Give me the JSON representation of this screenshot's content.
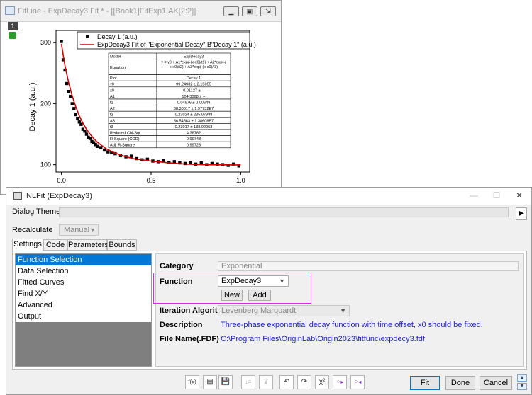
{
  "graph_window": {
    "title": "FitLine - ExpDecay3 Fit * - [[Book1]FitExp1!AK[2:2]]",
    "layer_number": "1",
    "legend": {
      "scatter_label": "Decay 1 (a.u.)",
      "fit_label": "ExpDecay3 Fit of \"Exponential Decay\" B\"Decay 1\" (a.u.)"
    },
    "y_axis_label": "Decay 1 (a.u.)",
    "x_ticks": [
      "0.0",
      "0.5",
      "1.0"
    ],
    "y_ticks": [
      "100",
      "200",
      "300"
    ],
    "results_table": {
      "header": [
        "Model",
        "ExpDecay3"
      ],
      "equation_label": "Equation",
      "equation_lines": [
        "y = y0 + A1*exp(-(x-x0)/t1) + A2*exp(-(",
        "x-x0)/t2) + A3*exp(-(x-x0)/t3)"
      ],
      "plot_row": [
        "Plot",
        "Decay 1"
      ],
      "rows": [
        [
          "y0",
          "99.24932 ± 2.15055"
        ],
        [
          "x0",
          "0.01127 ± --"
        ],
        [
          "A1",
          "104.3068 ± --"
        ],
        [
          "t1",
          "0.04976 ± 0.00649"
        ],
        [
          "A2",
          "38.30017 ± 1.97732E7"
        ],
        [
          "t2",
          "0.23024 ± 235.07988"
        ],
        [
          "A3",
          "56.54583 ± 1.38608E7"
        ],
        [
          "t3",
          "0.23017 ± 138.92953"
        ],
        [
          "Reduced Chi-Sqr",
          "4.38782"
        ],
        [
          "R-Square (COD)",
          "0.99748"
        ],
        [
          "Adj. R-Square",
          "0.99728"
        ]
      ]
    },
    "colors": {
      "fit_line": "#d40000",
      "scatter": "#000000"
    }
  },
  "chart_data": {
    "type": "scatter",
    "xlim": [
      -0.03,
      1.05
    ],
    "ylim": [
      88,
      320
    ],
    "series": [
      {
        "name": "Decay 1 (a.u.)",
        "x": [
          0.0,
          0.01,
          0.02,
          0.03,
          0.04,
          0.05,
          0.06,
          0.07,
          0.08,
          0.09,
          0.1,
          0.11,
          0.12,
          0.13,
          0.14,
          0.15,
          0.16,
          0.17,
          0.18,
          0.19,
          0.2,
          0.22,
          0.24,
          0.26,
          0.28,
          0.3,
          0.33,
          0.36,
          0.39,
          0.42,
          0.45,
          0.48,
          0.51,
          0.54,
          0.57,
          0.6,
          0.63,
          0.66,
          0.69,
          0.72,
          0.75,
          0.78,
          0.81,
          0.84,
          0.87,
          0.9,
          0.93,
          0.96,
          0.99
        ],
        "y": [
          302,
          272,
          255,
          233,
          220,
          212,
          200,
          192,
          182,
          176,
          170,
          166,
          158,
          155,
          150,
          145,
          143,
          138,
          136,
          133,
          130,
          128,
          124,
          121,
          120,
          118,
          115,
          113,
          114,
          110,
          108,
          109,
          106,
          105,
          107,
          104,
          105,
          103,
          102,
          104,
          101,
          103,
          100,
          102,
          101,
          100,
          99,
          101,
          98
        ]
      },
      {
        "name": "ExpDecay3 Fit of \"Exponential Decay\" B\"Decay 1\" (a.u.)",
        "x": [
          0.0,
          0.02,
          0.04,
          0.06,
          0.08,
          0.1,
          0.12,
          0.14,
          0.16,
          0.18,
          0.2,
          0.25,
          0.3,
          0.35,
          0.4,
          0.5,
          0.6,
          0.7,
          0.8,
          0.9,
          1.0
        ],
        "y": [
          298,
          262,
          235,
          213,
          195,
          180,
          168,
          158,
          150,
          143,
          137,
          126,
          119,
          114,
          110,
          106,
          103,
          101,
          100,
          99.8,
          99.5
        ]
      }
    ]
  },
  "dialog": {
    "title": "NLFit (ExpDecay3)",
    "window_buttons": [
      "—",
      "☐",
      "✕"
    ],
    "theme_label": "Dialog Theme",
    "theme_arrow": "▶",
    "recalc_label": "Recalculate",
    "recalc_value": "Manual",
    "tabs": [
      "Settings",
      "Code",
      "Parameters",
      "Bounds"
    ],
    "tree_items": [
      "Function Selection",
      "Data Selection",
      "Fitted Curves",
      "Find X/Y",
      "Advanced",
      "Output"
    ],
    "category_label": "Category",
    "category_value": "Exponential",
    "function_label": "Function",
    "function_value": "ExpDecay3",
    "new_button": "New",
    "add_button": "Add",
    "iteration_label": "Iteration Algorithm",
    "iteration_value": "Levenberg Marquardt",
    "description_label": "Description",
    "description_value": "Three-phase exponential decay function with time offset, x0 should be fixed.",
    "file_label": "File Name(.FDF)",
    "file_value": "C:\\Program Files\\OriginLab\\Origin2023\\fitfunc\\expdecy3.fdf",
    "toolbar_glyphs": [
      "f(x)",
      "▤",
      "💾",
      "↓≡",
      "⇪",
      "↶",
      "↷",
      "χ²",
      "⁘▸",
      "⁘◂"
    ],
    "fit_button": "Fit",
    "done_button": "Done",
    "cancel_button": "Cancel"
  }
}
